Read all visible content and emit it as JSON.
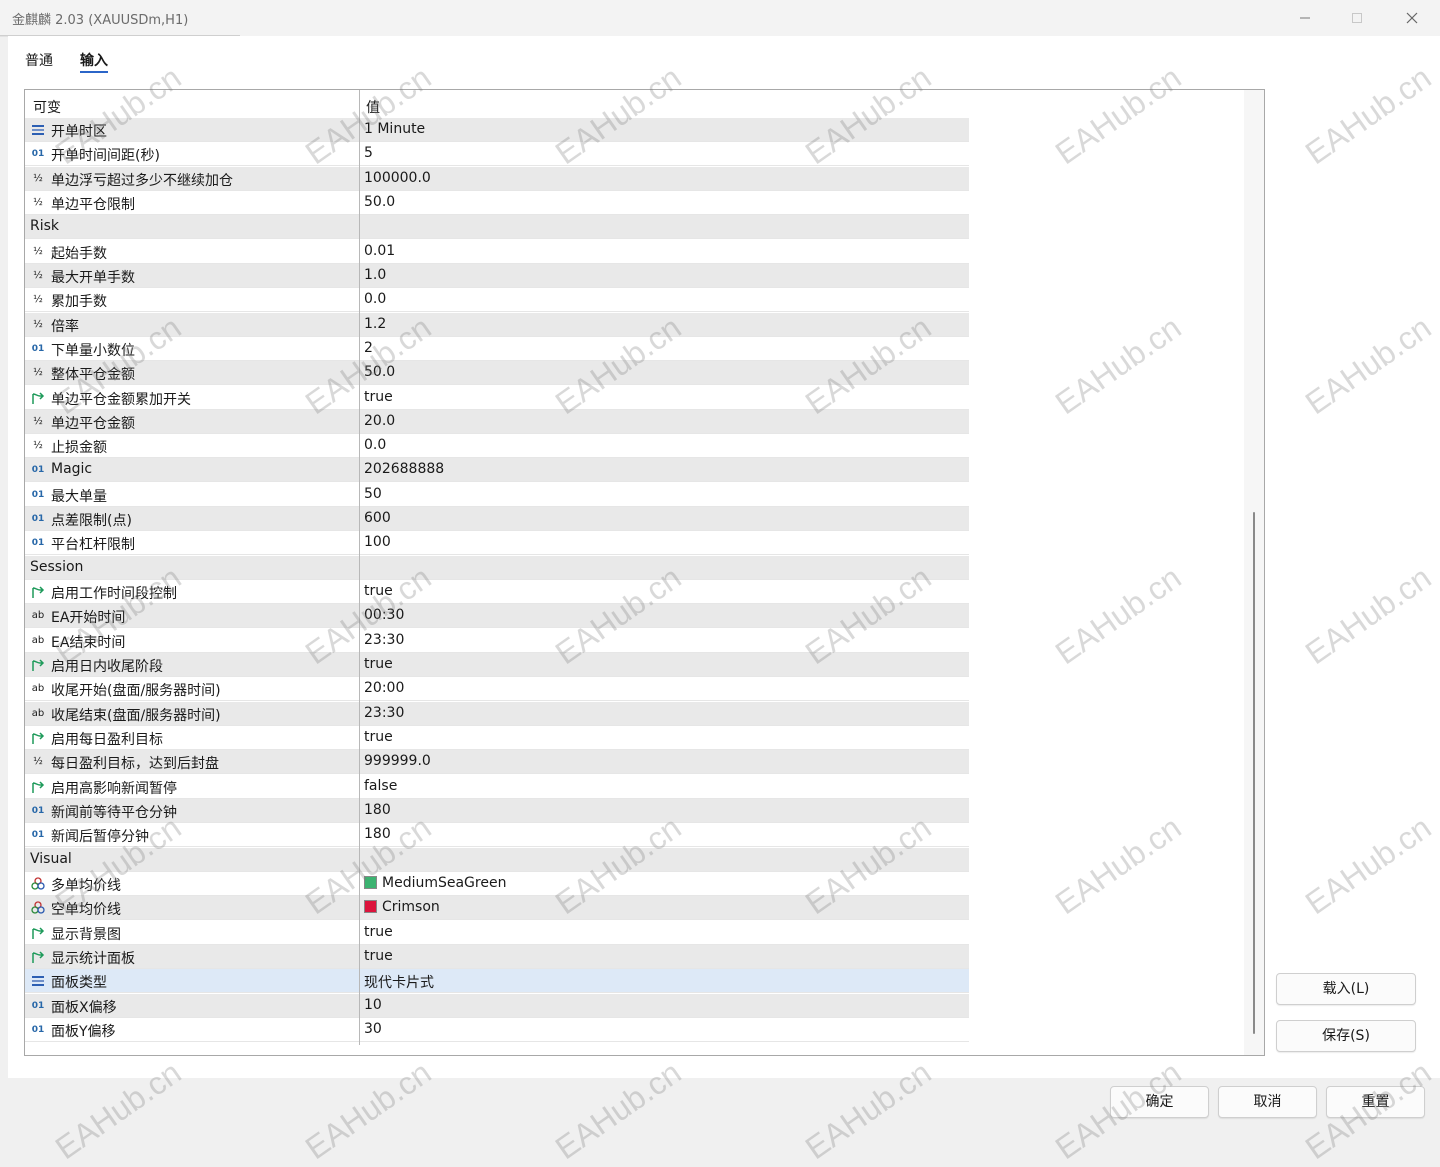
{
  "window": {
    "title": "金麒麟 2.03 (XAUUSDm,H1)"
  },
  "tabs": {
    "general": "普通",
    "inputs": "输入"
  },
  "grid": {
    "col_name": "可变",
    "col_value": "值",
    "rows": [
      {
        "icon": "enum",
        "name": "开单时区",
        "value": "1 Minute"
      },
      {
        "icon": "int",
        "name": "开单时间间距(秒)",
        "value": "5"
      },
      {
        "icon": "double",
        "name": "单边浮亏超过多少不继续加仓",
        "value": "100000.0"
      },
      {
        "icon": "double",
        "name": "单边平仓限制",
        "value": "50.0"
      },
      {
        "icon": "group",
        "name": "Risk",
        "value": ""
      },
      {
        "icon": "double",
        "name": "起始手数",
        "value": "0.01"
      },
      {
        "icon": "double",
        "name": "最大开单手数",
        "value": "1.0"
      },
      {
        "icon": "double",
        "name": "累加手数",
        "value": "0.0"
      },
      {
        "icon": "double",
        "name": "倍率",
        "value": "1.2"
      },
      {
        "icon": "int",
        "name": "下单量小数位",
        "value": "2"
      },
      {
        "icon": "double",
        "name": "整体平仓金额",
        "value": "50.0"
      },
      {
        "icon": "bool",
        "name": "单边平仓金额累加开关",
        "value": "true"
      },
      {
        "icon": "double",
        "name": "单边平仓金额",
        "value": "20.0"
      },
      {
        "icon": "double",
        "name": "止损金额",
        "value": "0.0"
      },
      {
        "icon": "int",
        "name": "Magic",
        "value": "202688888"
      },
      {
        "icon": "int",
        "name": "最大单量",
        "value": "50"
      },
      {
        "icon": "int",
        "name": "点差限制(点)",
        "value": "600"
      },
      {
        "icon": "int",
        "name": "平台杠杆限制",
        "value": "100"
      },
      {
        "icon": "group",
        "name": "Session",
        "value": ""
      },
      {
        "icon": "bool",
        "name": "启用工作时间段控制",
        "value": "true"
      },
      {
        "icon": "string",
        "name": "EA开始时间",
        "value": "00:30"
      },
      {
        "icon": "string",
        "name": "EA结束时间",
        "value": "23:30"
      },
      {
        "icon": "bool",
        "name": "启用日内收尾阶段",
        "value": "true"
      },
      {
        "icon": "string",
        "name": "收尾开始(盘面/服务器时间)",
        "value": "20:00"
      },
      {
        "icon": "string",
        "name": "收尾结束(盘面/服务器时间)",
        "value": "23:30"
      },
      {
        "icon": "bool",
        "name": "启用每日盈利目标",
        "value": "true"
      },
      {
        "icon": "double",
        "name": "每日盈利目标，达到后封盘",
        "value": "999999.0"
      },
      {
        "icon": "bool",
        "name": "启用高影响新闻暂停",
        "value": "false"
      },
      {
        "icon": "int",
        "name": "新闻前等待平仓分钟",
        "value": "180"
      },
      {
        "icon": "int",
        "name": "新闻后暂停分钟",
        "value": "180"
      },
      {
        "icon": "group",
        "name": "Visual",
        "value": ""
      },
      {
        "icon": "color",
        "name": "多单均价线",
        "value": "MediumSeaGreen",
        "swatch": "#3cb371"
      },
      {
        "icon": "color",
        "name": "空单均价线",
        "value": "Crimson",
        "swatch": "#dc143c"
      },
      {
        "icon": "bool",
        "name": "显示背景图",
        "value": "true"
      },
      {
        "icon": "bool",
        "name": "显示统计面板",
        "value": "true"
      },
      {
        "icon": "enum",
        "name": "面板类型",
        "value": "现代卡片式",
        "selected": true
      },
      {
        "icon": "int",
        "name": "面板X偏移",
        "value": "10"
      },
      {
        "icon": "int",
        "name": "面板Y偏移",
        "value": "30"
      }
    ]
  },
  "buttons": {
    "load": "载入(L)",
    "save": "保存(S)",
    "ok": "确定",
    "cancel": "取消",
    "reset": "重置"
  },
  "icon_glyphs": {
    "int": "01",
    "double": "½",
    "string": "ab"
  },
  "watermark": "EAHub.cn",
  "colors": {
    "selected_row": "#dde9f7",
    "alt_row": "#e9e9e9",
    "accent": "#2b65c8"
  }
}
